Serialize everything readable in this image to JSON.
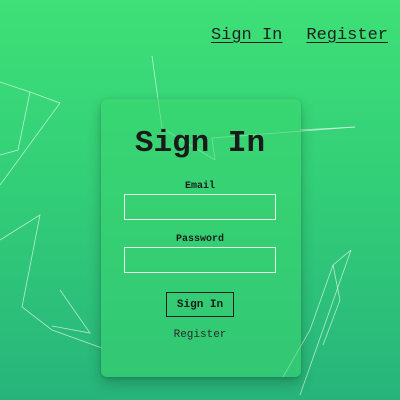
{
  "nav": {
    "sign_in": "Sign In",
    "register": "Register"
  },
  "form": {
    "title": "Sign In",
    "email_label": "Email",
    "email_value": "",
    "password_label": "Password",
    "password_value": "",
    "submit_label": "Sign In",
    "register_link": "Register"
  },
  "colors": {
    "background_top": "#3ee077",
    "background_bottom": "#27b47b",
    "text": "#1e1e1e"
  }
}
